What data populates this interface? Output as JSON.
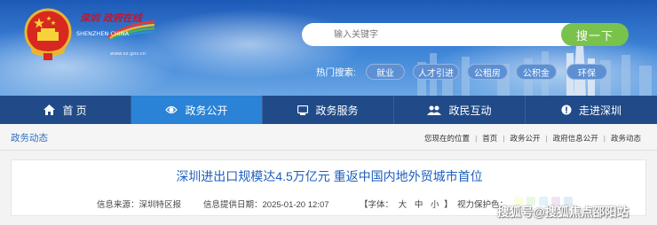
{
  "header": {
    "logo_cn": "深圳 政府在线",
    "logo_en": "SHENZHEN CHINA",
    "logo_url": "www.sz.gov.cn"
  },
  "search": {
    "placeholder": "输入关键字",
    "button_label": "搜一下"
  },
  "hot_search": {
    "label": "热门搜索:",
    "tags": [
      "就业",
      "人才引进",
      "公租房",
      "公积金",
      "环保"
    ]
  },
  "nav": {
    "items": [
      {
        "label": "首 页",
        "icon": "home-icon"
      },
      {
        "label": "政务公开",
        "icon": "open-government-icon"
      },
      {
        "label": "政务服务",
        "icon": "service-icon"
      },
      {
        "label": "政民互动",
        "icon": "interaction-icon"
      },
      {
        "label": "走进深圳",
        "icon": "about-shenzhen-icon"
      }
    ],
    "active_index": 1
  },
  "breadcrumb": {
    "section_title": "政务动态",
    "location_label": "您现在的位置",
    "items": [
      "首页",
      "政务公开",
      "政府信息公开",
      "政务动态"
    ]
  },
  "article": {
    "title": "深圳进出口规模达4.5万亿元 重返中国内地外贸城市首位",
    "source": "信息来源：深圳特区报",
    "date": "信息提供日期：2025-01-20 12:07",
    "font_open": "【字体：",
    "font_sizes": [
      "大",
      "中",
      "小"
    ],
    "font_close": "】",
    "vision_label": "视力保护色：",
    "vision_colors": [
      "#fdfde0",
      "#e9f9e4",
      "#dff3f8",
      "#f3e3f3",
      "#e1ecf7"
    ]
  },
  "watermark": "搜狐号@搜狐焦点邵阳站",
  "colors": {
    "nav_bg": "#214b88",
    "nav_active": "#2a83d6",
    "search_button": "#79c24b",
    "title_blue": "#1f5fbf"
  }
}
